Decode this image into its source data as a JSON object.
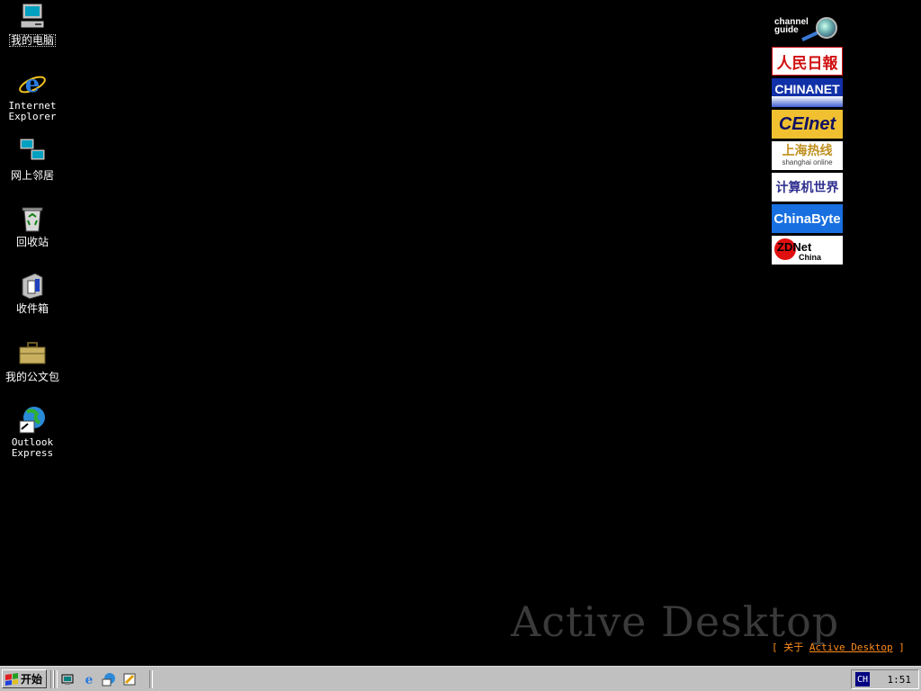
{
  "desktop": {
    "icons": [
      {
        "label": "我的电脑",
        "icon": "my-computer-icon"
      },
      {
        "label": "Internet Explorer",
        "icon": "internet-explorer-icon"
      },
      {
        "label": "网上邻居",
        "icon": "network-neighborhood-icon"
      },
      {
        "label": "回收站",
        "icon": "recycle-bin-icon"
      },
      {
        "label": "收件箱",
        "icon": "inbox-icon"
      },
      {
        "label": "我的公文包",
        "icon": "briefcase-icon"
      },
      {
        "label": "Outlook Express",
        "icon": "outlook-express-icon"
      }
    ],
    "watermark": "Active Desktop",
    "about_prefix": "关于",
    "about_link": "Active Desktop"
  },
  "channel_bar": {
    "guide_line1": "channel",
    "guide_line2": "guide",
    "channels": [
      {
        "label": "人民日報"
      },
      {
        "label": "CHINANET"
      },
      {
        "label": "CEInet"
      },
      {
        "label": "上海热线",
        "sub": "shanghai online"
      },
      {
        "label": "计算机世界"
      },
      {
        "label": "ChinaByte"
      },
      {
        "label": "ZDNet",
        "sub": "China"
      }
    ]
  },
  "taskbar": {
    "start_label": "开始",
    "ime_label": "CH",
    "clock": "1:51"
  }
}
